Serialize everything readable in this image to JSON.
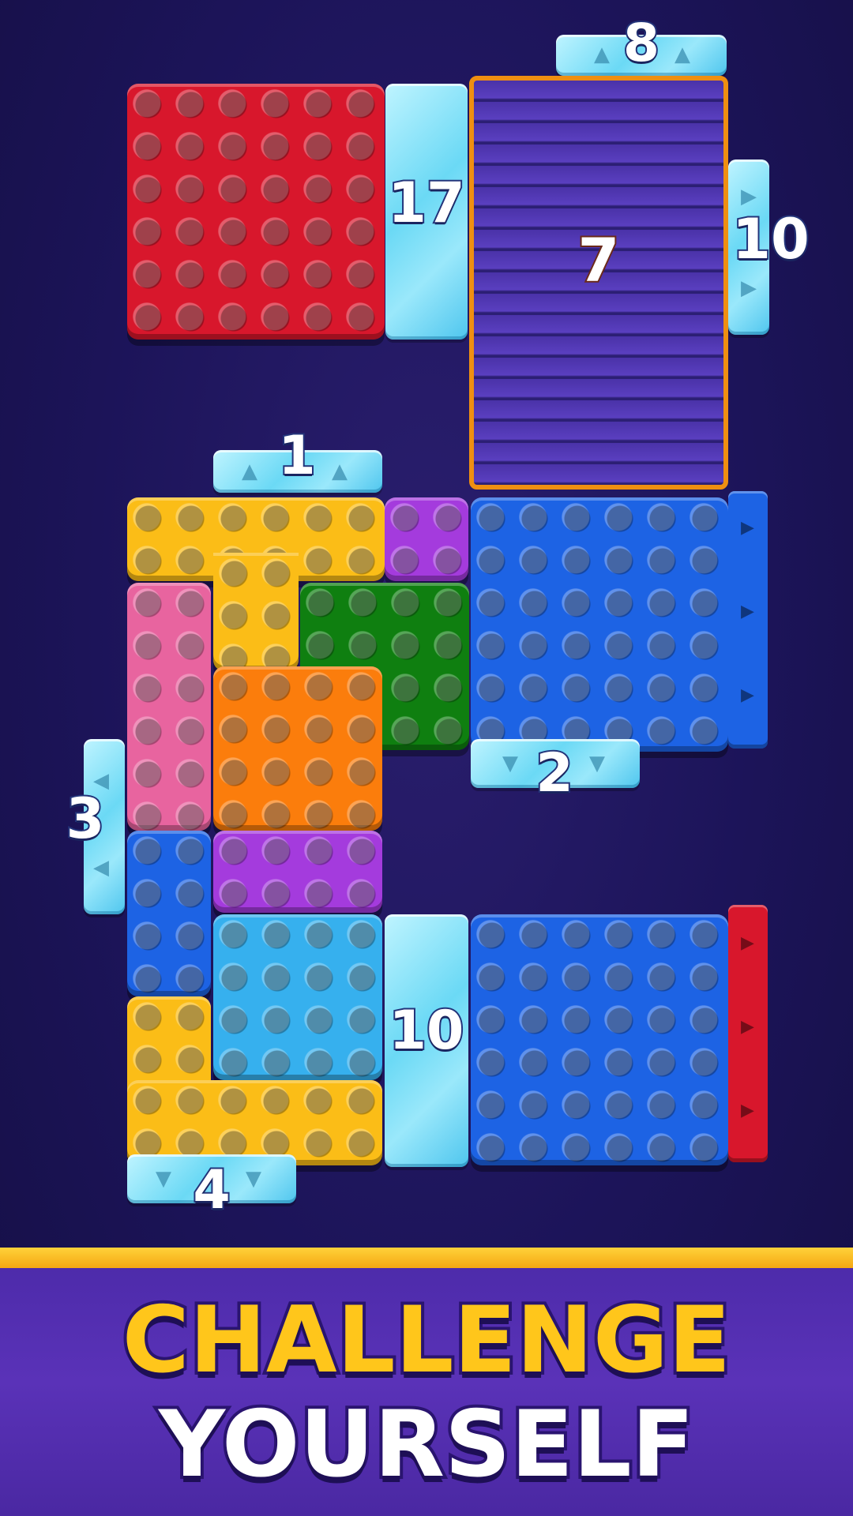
{
  "colors": {
    "red": "#d8172c",
    "yellow": "#fbbd17",
    "purple": "#a43bdd",
    "blue": "#1d63e4",
    "green": "#0f7f10",
    "pink": "#e8649f",
    "orange": "#fb7d0c",
    "light_blue": "#36b0ee",
    "cage_border": "#ef8f11",
    "banner_stripe": "#ffd23a"
  },
  "ice_counters": {
    "top_exit_counter": "8",
    "right_exit_counter": "10",
    "red_block_ice": "17",
    "cage_counter": "7",
    "yellow_top_counter": "1",
    "blue_bottom_counter": "2",
    "left_exit_counter": "3",
    "bottom_left_counter": "4",
    "middle_ice": "10"
  },
  "banner": {
    "line1": "CHALLENGE",
    "line2": "YOURSELF"
  }
}
